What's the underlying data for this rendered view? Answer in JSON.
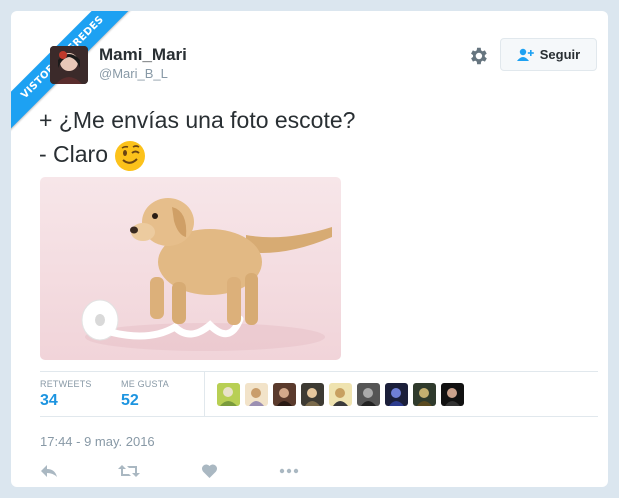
{
  "watermark": {
    "text": "VISTOENLASREDES"
  },
  "user": {
    "name": "Mami_Mari",
    "handle": "@Mari_B_L"
  },
  "header": {
    "follow_label": "Seguir",
    "icons": [
      "gear-icon",
      "add-user-icon"
    ]
  },
  "tweet": {
    "line1": "+ ¿Me envías una foto escote?",
    "line2": "- Claro",
    "emoji": "winking-face",
    "photo": "puppy-with-toilet-paper"
  },
  "stats": {
    "retweets_label": "RETWEETS",
    "retweets_value": "34",
    "likes_label": "ME GUSTA",
    "likes_value": "52",
    "likers_count": 9
  },
  "timestamp": "17:44 - 9 may. 2016",
  "actions": [
    "reply-icon",
    "retweet-icon",
    "like-icon",
    "more-icon"
  ],
  "colors": {
    "brand": "#1da1f2",
    "stat_value": "#1c94e0",
    "muted": "#8899a6",
    "text": "#292f33"
  }
}
